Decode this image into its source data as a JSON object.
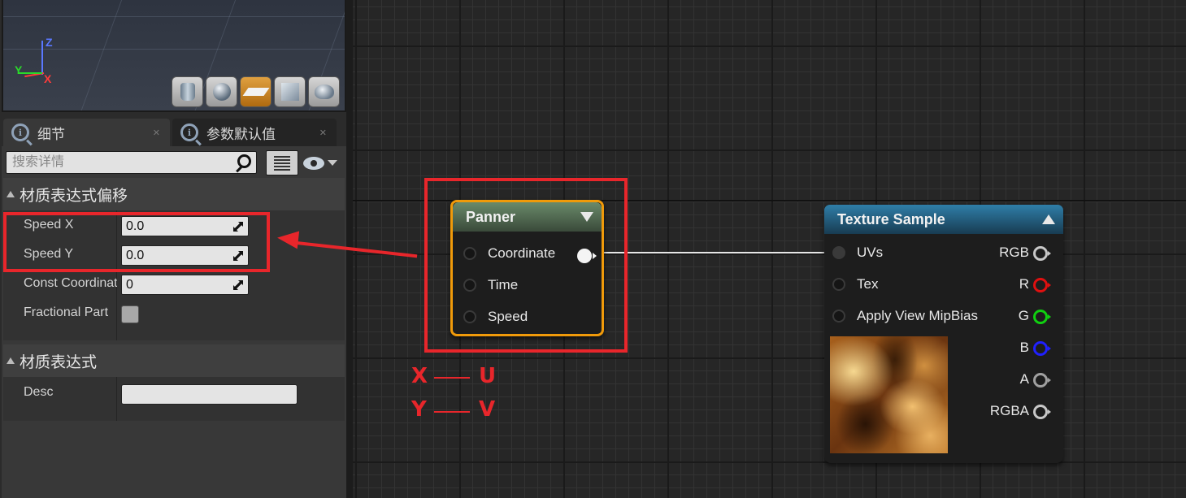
{
  "viewport": {
    "axes": {
      "z": "Z",
      "x": "X",
      "y": "Y"
    },
    "preview_shapes": [
      "cylinder-icon",
      "sphere-icon",
      "plane-icon",
      "cube-icon",
      "teapot-icon"
    ],
    "active_shape": "plane-icon"
  },
  "tabs": [
    {
      "label": "细节",
      "icon": "magnifier-info-icon",
      "active": true
    },
    {
      "label": "参数默认值",
      "icon": "magnifier-info-icon",
      "active": false
    }
  ],
  "details": {
    "search_placeholder": "搜索详情",
    "categories": [
      {
        "title": "材质表达式偏移",
        "properties": [
          {
            "label": "Speed X",
            "value": "0.0"
          },
          {
            "label": "Speed Y",
            "value": "0.0"
          },
          {
            "label": "Const Coordinate",
            "value": "0"
          },
          {
            "label": "Fractional Part",
            "checked": false
          }
        ]
      },
      {
        "title": "材质表达式",
        "properties": [
          {
            "label": "Desc",
            "value": ""
          }
        ]
      }
    ]
  },
  "graph": {
    "panner": {
      "title": "Panner",
      "inputs": [
        "Coordinate",
        "Time",
        "Speed"
      ]
    },
    "texture_sample": {
      "title": "Texture Sample",
      "inputs": [
        "UVs",
        "Tex",
        "Apply View MipBias"
      ],
      "outputs": [
        {
          "label": "RGB",
          "color": "#c8c8c8"
        },
        {
          "label": "R",
          "color": "#e01010"
        },
        {
          "label": "G",
          "color": "#10d010"
        },
        {
          "label": "B",
          "color": "#2020ff"
        },
        {
          "label": "A",
          "color": "#a0a0a0"
        },
        {
          "label": "RGBA",
          "color": "#c8c8c8"
        }
      ]
    },
    "annotations": {
      "row1": {
        "left": "X",
        "right": "U"
      },
      "row2": {
        "left": "Y",
        "right": "V"
      },
      "color": "#e8262b"
    }
  }
}
